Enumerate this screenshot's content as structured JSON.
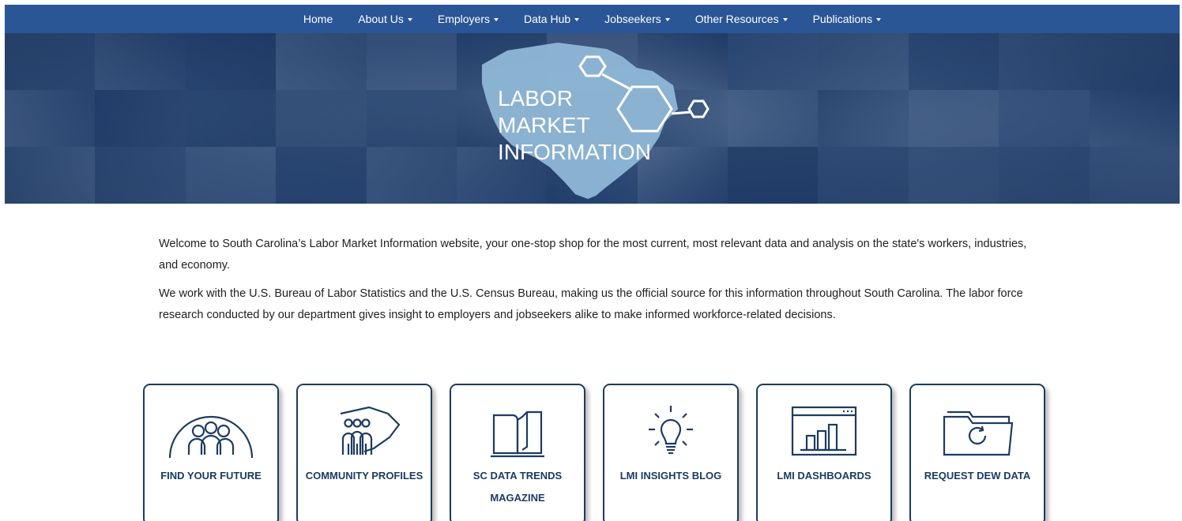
{
  "nav": {
    "items": [
      {
        "label": "Home",
        "dropdown": false
      },
      {
        "label": "About Us",
        "dropdown": true
      },
      {
        "label": "Employers",
        "dropdown": true
      },
      {
        "label": "Data Hub",
        "dropdown": true
      },
      {
        "label": "Jobseekers",
        "dropdown": true
      },
      {
        "label": "Other Resources",
        "dropdown": true
      },
      {
        "label": "Publications",
        "dropdown": true
      }
    ],
    "bg_color": "#2a5597"
  },
  "banner": {
    "logo_line1": "LABOR",
    "logo_line2": "MARKET",
    "logo_line3": "INFORMATION",
    "state_shape_color": "#8fb7d6"
  },
  "intro": {
    "paragraph1": "Welcome to South Carolina’s Labor Market Information website, your one-stop shop for the most current, most relevant data and analysis on the state's workers, industries, and economy.",
    "paragraph2": "We work with the U.S. Bureau of Labor Statistics and the U.S. Census Bureau, making us the official source for this information throughout South Carolina. The labor force research conducted by our department gives insight to employers and jobseekers alike to make informed workforce-related decisions."
  },
  "cards": [
    {
      "label": "FIND YOUR FUTURE",
      "icon": "people-arch-icon"
    },
    {
      "label": "COMMUNITY PROFILES",
      "icon": "community-state-icon"
    },
    {
      "label": "SC DATA TRENDS MAGAZINE",
      "icon": "open-book-icon"
    },
    {
      "label": "LMI INSIGHTS BLOG",
      "icon": "lightbulb-icon"
    },
    {
      "label": "LMI DASHBOARDS",
      "icon": "dashboard-chart-icon"
    },
    {
      "label": "REQUEST DEW DATA",
      "icon": "folder-refresh-icon"
    }
  ],
  "colors": {
    "brand_dark": "#1d3b62",
    "nav_blue": "#2a5597"
  }
}
